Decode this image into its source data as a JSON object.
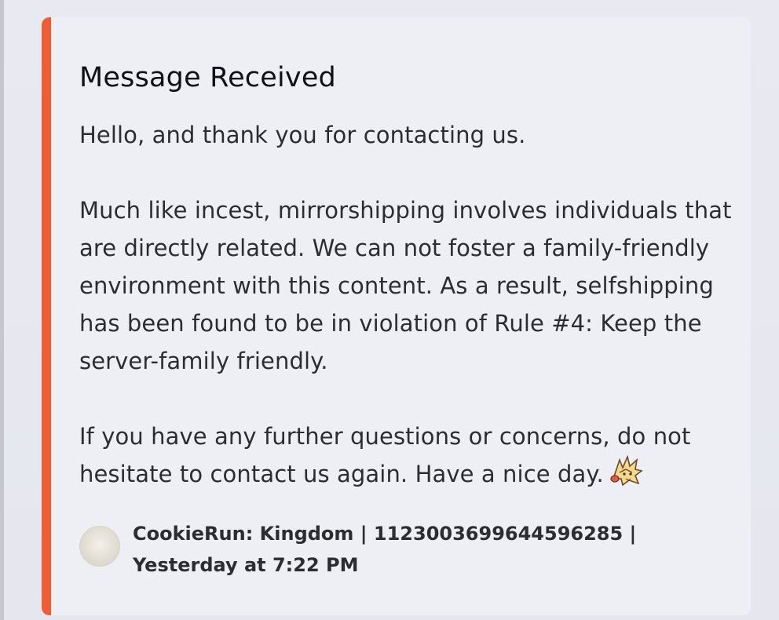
{
  "embed": {
    "accent_color": "#ef5d34",
    "title": "Message Received",
    "paragraphs": [
      "Hello, and thank you for contacting us.",
      "Much like incest, mirrorshipping involves individuals that are directly related. We can not foster a family-friendly environment with this content. As a result, selfshipping has been found to be in violation of Rule #4: Keep the server-family friendly.",
      "If you have any further questions or concerns, do not hesitate to contact us again. Have a nice day."
    ],
    "closing_emoji": "cookie-character-emoji",
    "footer": {
      "text": "CookieRun: Kingdom | 1123003699644596285 | Yesterday at 7:22 PM",
      "avatar_icon": "server-avatar-icon"
    }
  }
}
